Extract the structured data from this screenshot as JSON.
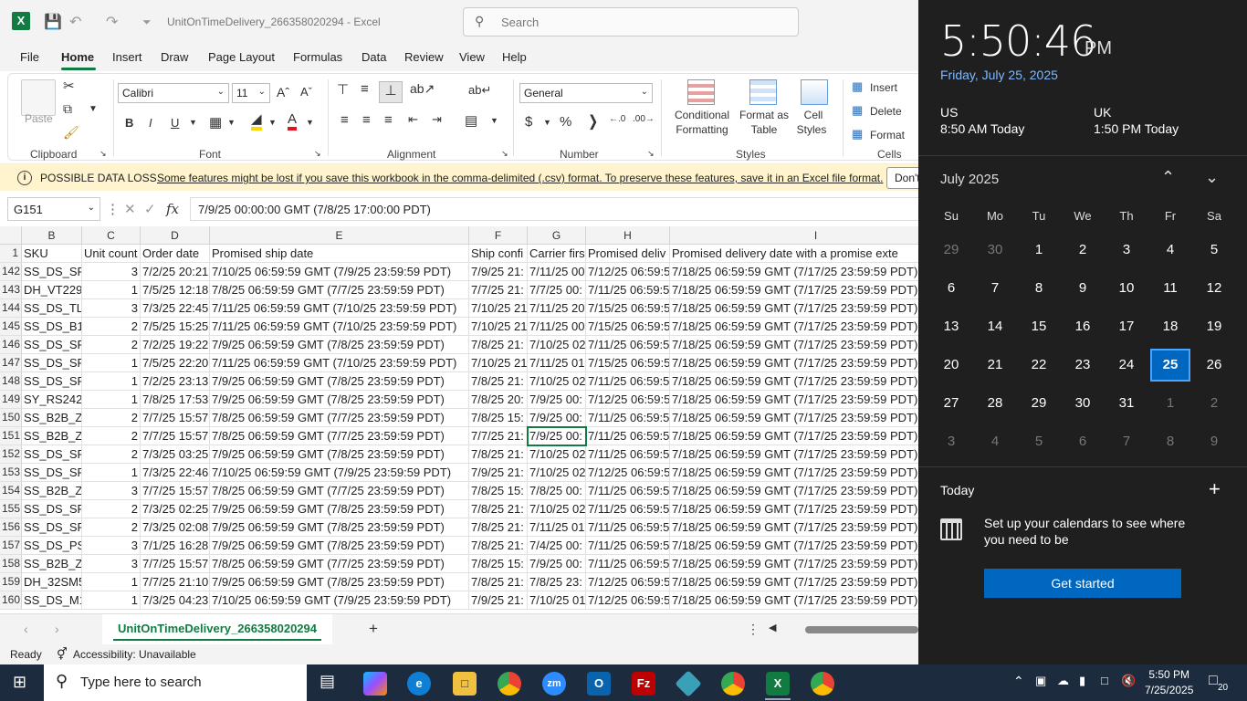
{
  "app": {
    "title": "UnitOnTimeDelivery_266358020294  -  Excel",
    "search_placeholder": "Search",
    "accent": "#107c41"
  },
  "menu": [
    "File",
    "Home",
    "Insert",
    "Draw",
    "Page Layout",
    "Formulas",
    "Data",
    "Review",
    "View",
    "Help"
  ],
  "ribbon": {
    "clipboard": {
      "paste": "Paste",
      "label": "Clipboard"
    },
    "font": {
      "name": "Calibri",
      "size": "11",
      "label": "Font",
      "bold": "B",
      "italic": "I",
      "underline": "U"
    },
    "alignment": {
      "label": "Alignment"
    },
    "number": {
      "format": "General",
      "label": "Number"
    },
    "styles": {
      "conditional": "Conditional",
      "conditional2": "Formatting",
      "format_as": "Format as",
      "table": "Table",
      "cell": "Cell",
      "styles_word": "Styles",
      "label": "Styles"
    },
    "cells": {
      "insert": "Insert",
      "delete": "Delete",
      "format": "Format",
      "label": "Cells"
    }
  },
  "infobar": {
    "heading": "POSSIBLE DATA LOSS",
    "message": "Some features might be lost if you save this workbook in the comma-delimited (.csv) format. To preserve these features, save it in an Excel file format.",
    "button": "Don't"
  },
  "formula_bar": {
    "name_box": "G151",
    "formula": "7/9/25 00:00:00 GMT (7/8/25 17:00:00 PDT)"
  },
  "grid": {
    "column_letters": [
      "B",
      "C",
      "D",
      "E",
      "F",
      "G",
      "H",
      "I"
    ],
    "header_row": {
      "num": "1",
      "cells": [
        "SKU",
        "Unit count",
        "Order date",
        "Promised ship date",
        "Ship confi",
        "Carrier firs",
        "Promised deliv",
        "Promised delivery date with a promise exte"
      ]
    },
    "rows": [
      {
        "num": "142",
        "cells": [
          "SS_DS_SR4",
          "3",
          "7/2/25 20:21",
          "7/10/25 06:59:59 GMT (7/9/25 23:59:59 PDT)",
          "7/9/25 21:",
          "7/11/25 00",
          "7/12/25 06:59:5",
          "7/18/25 06:59:59 GMT (7/17/25 23:59:59 PDT)"
        ]
      },
      {
        "num": "143",
        "cells": [
          "DH_VT229",
          "1",
          "7/5/25 12:18",
          "7/8/25 06:59:59 GMT (7/7/25 23:59:59 PDT)",
          "7/7/25 21:",
          "7/7/25 00:",
          "7/11/25 06:59:5",
          "7/18/25 06:59:59 GMT (7/17/25 23:59:59 PDT)"
        ]
      },
      {
        "num": "144",
        "cells": [
          "SS_DS_TLF",
          "3",
          "7/3/25 22:45",
          "7/11/25 06:59:59 GMT (7/10/25 23:59:59 PDT)",
          "7/10/25 21",
          "7/11/25 20",
          "7/15/25 06:59:5",
          "7/18/25 06:59:59 GMT (7/17/25 23:59:59 PDT)"
        ]
      },
      {
        "num": "145",
        "cells": [
          "SS_DS_B15",
          "2",
          "7/5/25 15:25",
          "7/11/25 06:59:59 GMT (7/10/25 23:59:59 PDT)",
          "7/10/25 21",
          "7/11/25 00",
          "7/15/25 06:59:5",
          "7/18/25 06:59:59 GMT (7/17/25 23:59:59 PDT)"
        ]
      },
      {
        "num": "146",
        "cells": [
          "SS_DS_SPI",
          "2",
          "7/2/25 19:22",
          "7/9/25 06:59:59 GMT (7/8/25 23:59:59 PDT)",
          "7/8/25 21:",
          "7/10/25 02",
          "7/11/25 06:59:5",
          "7/18/25 06:59:59 GMT (7/17/25 23:59:59 PDT)"
        ]
      },
      {
        "num": "147",
        "cells": [
          "SS_DS_SPI",
          "1",
          "7/5/25 22:20",
          "7/11/25 06:59:59 GMT (7/10/25 23:59:59 PDT)",
          "7/10/25 21",
          "7/11/25 01",
          "7/15/25 06:59:5",
          "7/18/25 06:59:59 GMT (7/17/25 23:59:59 PDT)"
        ]
      },
      {
        "num": "148",
        "cells": [
          "SS_DS_SPI",
          "1",
          "7/2/25 23:13",
          "7/9/25 06:59:59 GMT (7/8/25 23:59:59 PDT)",
          "7/8/25 21:",
          "7/10/25 02",
          "7/11/25 06:59:5",
          "7/18/25 06:59:59 GMT (7/17/25 23:59:59 PDT)"
        ]
      },
      {
        "num": "149",
        "cells": [
          "SY_RS2423",
          "1",
          "7/8/25 17:53",
          "7/9/25 06:59:59 GMT (7/8/25 23:59:59 PDT)",
          "7/8/25 20:",
          "7/9/25 00:",
          "7/12/25 06:59:5",
          "7/18/25 06:59:59 GMT (7/17/25 23:59:59 PDT)"
        ]
      },
      {
        "num": "150",
        "cells": [
          "SS_B2B_ZI",
          "2",
          "7/7/25 15:57",
          "7/8/25 06:59:59 GMT (7/7/25 23:59:59 PDT)",
          "7/8/25 15:",
          "7/9/25 00:",
          "7/11/25 06:59:5",
          "7/18/25 06:59:59 GMT (7/17/25 23:59:59 PDT)"
        ]
      },
      {
        "num": "151",
        "cells": [
          "SS_B2B_ZI",
          "2",
          "7/7/25 15:57",
          "7/8/25 06:59:59 GMT (7/7/25 23:59:59 PDT)",
          "7/7/25 21:",
          "7/9/25 00:",
          "7/11/25 06:59:5",
          "7/18/25 06:59:59 GMT (7/17/25 23:59:59 PDT)"
        ]
      },
      {
        "num": "152",
        "cells": [
          "SS_DS_SPI",
          "2",
          "7/3/25 03:25",
          "7/9/25 06:59:59 GMT (7/8/25 23:59:59 PDT)",
          "7/8/25 21:",
          "7/10/25 02",
          "7/11/25 06:59:5",
          "7/18/25 06:59:59 GMT (7/17/25 23:59:59 PDT)"
        ]
      },
      {
        "num": "153",
        "cells": [
          "SS_DS_SPI",
          "1",
          "7/3/25 22:46",
          "7/10/25 06:59:59 GMT (7/9/25 23:59:59 PDT)",
          "7/9/25 21:",
          "7/10/25 02",
          "7/12/25 06:59:5",
          "7/18/25 06:59:59 GMT (7/17/25 23:59:59 PDT)"
        ]
      },
      {
        "num": "154",
        "cells": [
          "SS_B2B_ZI",
          "3",
          "7/7/25 15:57",
          "7/8/25 06:59:59 GMT (7/7/25 23:59:59 PDT)",
          "7/8/25 15:",
          "7/8/25 00:",
          "7/11/25 06:59:5",
          "7/18/25 06:59:59 GMT (7/17/25 23:59:59 PDT)"
        ]
      },
      {
        "num": "155",
        "cells": [
          "SS_DS_SPI",
          "2",
          "7/3/25 02:25",
          "7/9/25 06:59:59 GMT (7/8/25 23:59:59 PDT)",
          "7/8/25 21:",
          "7/10/25 02",
          "7/11/25 06:59:5",
          "7/18/25 06:59:59 GMT (7/17/25 23:59:59 PDT)"
        ]
      },
      {
        "num": "156",
        "cells": [
          "SS_DS_SPI",
          "2",
          "7/3/25 02:08",
          "7/9/25 06:59:59 GMT (7/8/25 23:59:59 PDT)",
          "7/8/25 21:",
          "7/11/25 01",
          "7/11/25 06:59:5",
          "7/18/25 06:59:59 GMT (7/17/25 23:59:59 PDT)"
        ]
      },
      {
        "num": "157",
        "cells": [
          "SS_DS_PS-",
          "3",
          "7/1/25 16:28",
          "7/9/25 06:59:59 GMT (7/8/25 23:59:59 PDT)",
          "7/8/25 21:",
          "7/4/25 00:",
          "7/11/25 06:59:5",
          "7/18/25 06:59:59 GMT (7/17/25 23:59:59 PDT)"
        ]
      },
      {
        "num": "158",
        "cells": [
          "SS_B2B_ZI",
          "3",
          "7/7/25 15:57",
          "7/8/25 06:59:59 GMT (7/7/25 23:59:59 PDT)",
          "7/8/25 15:",
          "7/9/25 00:",
          "7/11/25 06:59:5",
          "7/18/25 06:59:59 GMT (7/17/25 23:59:59 PDT)"
        ]
      },
      {
        "num": "159",
        "cells": [
          "DH_32SM5",
          "1",
          "7/7/25 21:10",
          "7/9/25 06:59:59 GMT (7/8/25 23:59:59 PDT)",
          "7/8/25 21:",
          "7/8/25 23:",
          "7/12/25 06:59:5",
          "7/18/25 06:59:59 GMT (7/17/25 23:59:59 PDT)"
        ]
      },
      {
        "num": "160",
        "cells": [
          "SS_DS_M1",
          "1",
          "7/3/25 04:23",
          "7/10/25 06:59:59 GMT (7/9/25 23:59:59 PDT)",
          "7/9/25 21:",
          "7/10/25 01",
          "7/12/25 06:59:5",
          "7/18/25 06:59:59 GMT (7/17/25 23:59:59 PDT)"
        ]
      }
    ]
  },
  "sheet_tab": "UnitOnTimeDelivery_266358020294",
  "status": {
    "ready": "Ready",
    "accessibility": "Accessibility: Unavailable"
  },
  "flyout": {
    "time": "5:50:46",
    "ampm": "PM",
    "date": "Friday, July 25, 2025",
    "zones": [
      {
        "name": "US",
        "time": "8:50 AM Today"
      },
      {
        "name": "UK",
        "time": "1:50 PM Today"
      }
    ],
    "month": "July 2025",
    "dow": [
      "Su",
      "Mo",
      "Tu",
      "We",
      "Th",
      "Fr",
      "Sa"
    ],
    "weeks": [
      [
        "29",
        "30",
        "1",
        "2",
        "3",
        "4",
        "5"
      ],
      [
        "6",
        "7",
        "8",
        "9",
        "10",
        "11",
        "12"
      ],
      [
        "13",
        "14",
        "15",
        "16",
        "17",
        "18",
        "19"
      ],
      [
        "20",
        "21",
        "22",
        "23",
        "24",
        "25",
        "26"
      ],
      [
        "27",
        "28",
        "29",
        "30",
        "31",
        "1",
        "2"
      ],
      [
        "3",
        "4",
        "5",
        "6",
        "7",
        "8",
        "9"
      ]
    ],
    "today_label": "Today",
    "cal_text": "Set up your calendars to see where you need to be",
    "get_started": "Get started"
  },
  "taskbar": {
    "search_placeholder": "Type here to search",
    "clock_time": "5:50 PM",
    "clock_date": "7/25/2025",
    "notification_count": "20"
  }
}
